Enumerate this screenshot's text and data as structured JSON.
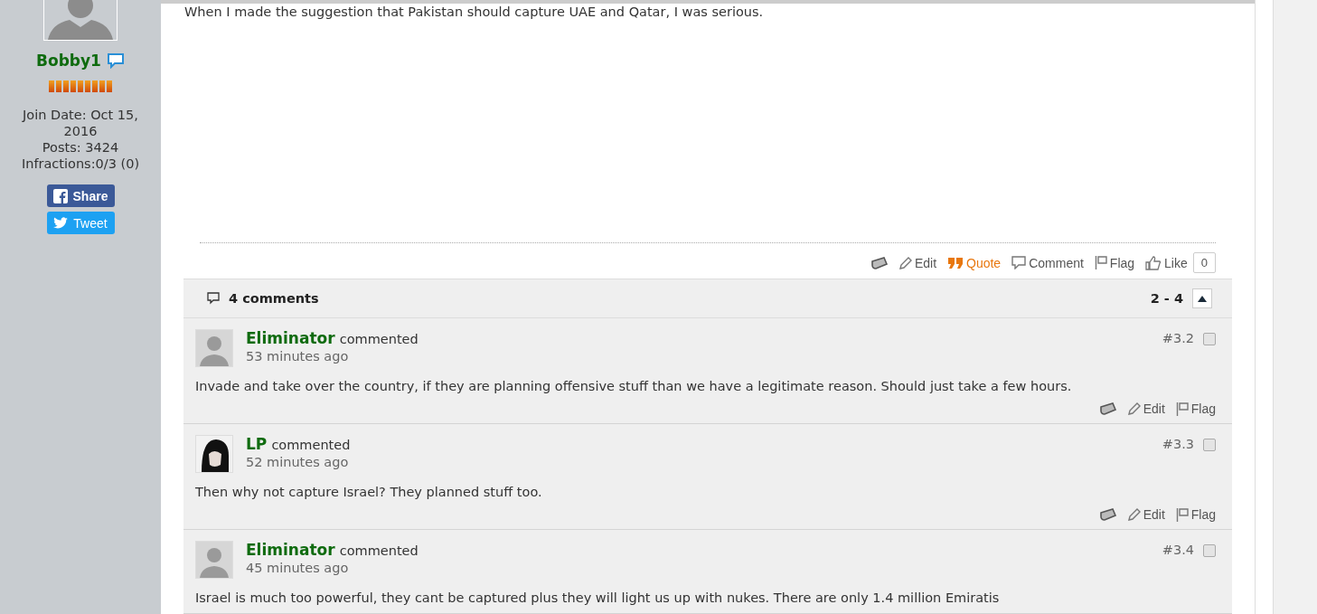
{
  "user": {
    "name": "Bobby1",
    "info": [
      "Join Date: Oct 15, 2016",
      "Posts: 3424",
      "Infractions:0/3 (0)"
    ],
    "share_label": "Share",
    "tweet_label": "Tweet"
  },
  "post": {
    "text": "When I made the suggestion that Pakistan should capture UAE and Qatar, I was serious.",
    "actions": [
      {
        "kind": "tag"
      },
      {
        "kind": "edit",
        "label": "Edit"
      },
      {
        "kind": "quote",
        "label": "Quote"
      },
      {
        "kind": "comment",
        "label": "Comment"
      },
      {
        "kind": "flag",
        "label": "Flag"
      },
      {
        "kind": "like",
        "label": "Like"
      }
    ],
    "like_count": "0"
  },
  "comments_header": {
    "count": "4 comments",
    "range": "2 - 4"
  },
  "comments": [
    {
      "kind": "placeholder",
      "author": "Eliminator",
      "verb": "commented",
      "time": "53 minutes ago",
      "number": "#3.2",
      "checked": false,
      "text": "Invade and take over the country, if they are planning offensive stuff than we have a legitimate reason. Should just take a few hours.",
      "actions": [
        {
          "kind": "tag"
        },
        {
          "kind": "edit",
          "label": "Edit"
        },
        {
          "kind": "flag",
          "label": "Flag"
        }
      ]
    },
    {
      "kind": "picture",
      "author": "LP",
      "verb": "commented",
      "time": "52 minutes ago",
      "number": "#3.3",
      "checked": false,
      "text": "Then why not capture Israel? They planned stuff too.",
      "actions": [
        {
          "kind": "tag"
        },
        {
          "kind": "edit",
          "label": "Edit"
        },
        {
          "kind": "flag",
          "label": "Flag"
        }
      ]
    },
    {
      "kind": "placeholder",
      "author": "Eliminator",
      "verb": "commented",
      "time": "45 minutes ago",
      "number": "#3.4",
      "checked": false,
      "text": "Israel is much too powerful, they cant be captured plus they will light us up with nukes. There are only 1.4 million Emiratis"
    }
  ]
}
